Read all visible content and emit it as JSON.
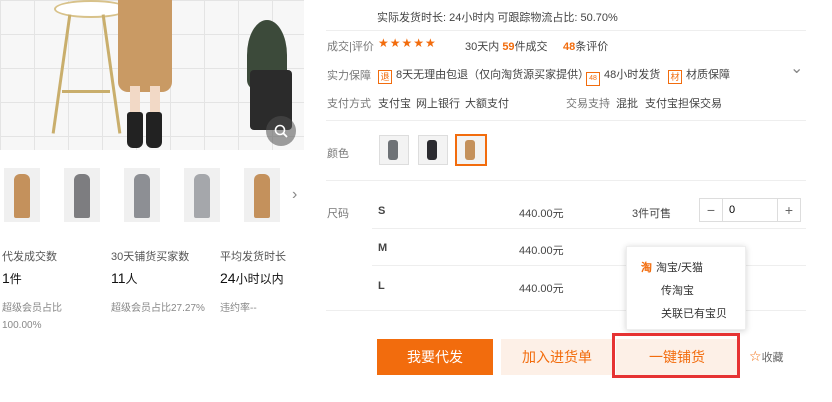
{
  "gallery": {
    "zoom_icon": "magnifier-icon",
    "next_icon": "chevron-right-icon",
    "next_glyph": "›"
  },
  "stats": [
    {
      "label": "代发成交数",
      "value": "1",
      "unit": "件",
      "sub": "超级会员占比",
      "sub2": "100.00%"
    },
    {
      "label": "30天铺货买家数",
      "value": "11",
      "unit": "人",
      "sub": "超级会员占比27.27%",
      "sub2": ""
    },
    {
      "label": "平均发货时长",
      "value": "24",
      "unit": "小时以内",
      "sub": "违约率--",
      "sub2": ""
    }
  ],
  "shipping": {
    "line": "实际发货时长: 24小时内   可跟踪物流占比: 50.70%"
  },
  "reviews": {
    "label": "成交|评价",
    "stars": "★★★★★",
    "sales_prefix": "30天内",
    "sales_count": "59",
    "sales_suffix": "件成交",
    "review_count": "48",
    "review_suffix": "条评价"
  },
  "guarantee": {
    "label": "实力保障",
    "items": [
      {
        "icon": "return-icon",
        "glyph": "退",
        "text": "8天无理由包退（仅向淘货源买家提供）"
      },
      {
        "icon": "clock-icon",
        "glyph": "48",
        "text": "48小时发货"
      },
      {
        "icon": "material-icon",
        "glyph": "材",
        "text": "材质保障"
      }
    ],
    "expand_icon": "chevron-down-icon",
    "expand_glyph": "⌄"
  },
  "payment": {
    "label": "支付方式",
    "methods": [
      "支付宝",
      "网上银行",
      "大额支付"
    ],
    "trade_label": "交易支持",
    "trade_methods": [
      "混批",
      "支付宝担保交易"
    ]
  },
  "color": {
    "label": "颜色"
  },
  "size": {
    "label": "尺码",
    "rows": [
      {
        "size": "S",
        "price": "440.00元",
        "stock": "3件可售",
        "qty": "0"
      },
      {
        "size": "M",
        "price": "440.00元",
        "stock": "",
        "qty": ""
      },
      {
        "size": "L",
        "price": "440.00元",
        "stock": "",
        "qty": ""
      }
    ],
    "minus": "−",
    "plus": "+"
  },
  "dropdown": {
    "items": [
      {
        "label": "淘宝/天猫",
        "icon": "taobao-icon",
        "glyph": "淘"
      },
      {
        "label": "传淘宝",
        "icon": "",
        "glyph": ""
      },
      {
        "label": "关联已有宝贝",
        "icon": "",
        "glyph": ""
      }
    ]
  },
  "actions": {
    "primary": "我要代发",
    "secondary": "加入进货单",
    "distribute": "一键铺货",
    "favorite_icon": "star-outline-icon",
    "favorite_glyph": "☆",
    "favorite": "收藏"
  },
  "colors": {
    "accent": "#f26c0d",
    "highlight": "#e63333"
  }
}
